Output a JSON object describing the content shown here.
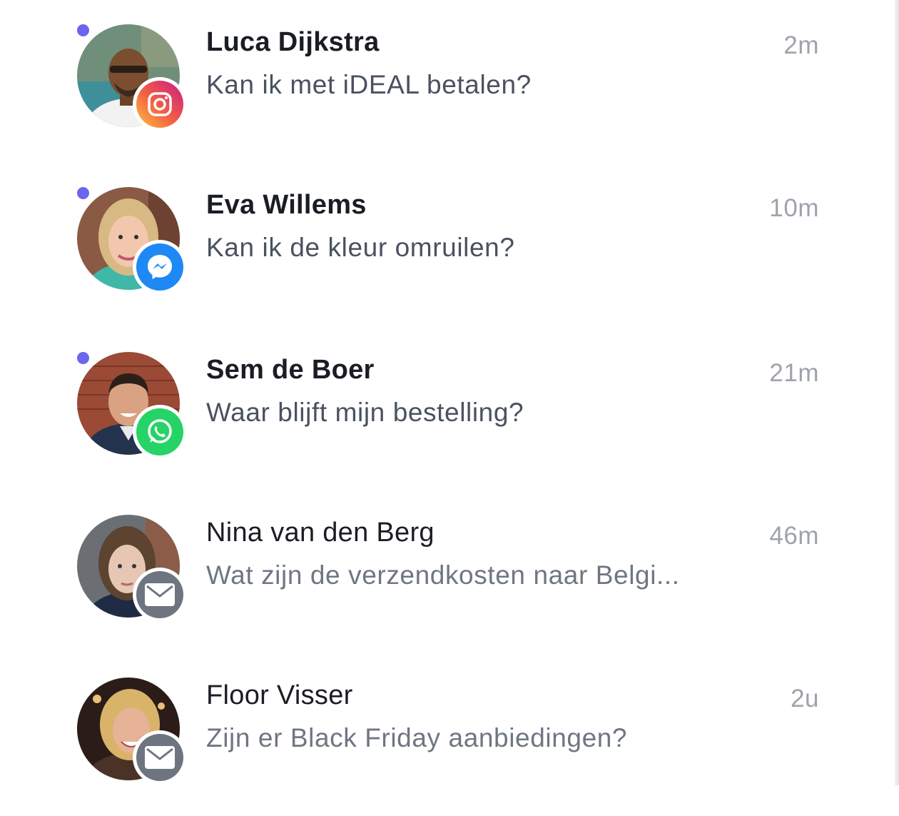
{
  "conversations": [
    {
      "name": "Luca Dijkstra",
      "message": "Kan ik met iDEAL betalen?",
      "time": "2m",
      "unread": true,
      "channel": "instagram-icon"
    },
    {
      "name": "Eva Willems",
      "message": "Kan ik de kleur omruilen?",
      "time": "10m",
      "unread": true,
      "channel": "messenger-icon"
    },
    {
      "name": "Sem de Boer",
      "message": "Waar blijft mijn bestelling?",
      "time": "21m",
      "unread": true,
      "channel": "whatsapp-icon"
    },
    {
      "name": "Nina van den Berg",
      "message": "Wat zijn de verzendkosten naar Belgi...",
      "time": "46m",
      "unread": false,
      "channel": "mail-icon"
    },
    {
      "name": "Floor Visser",
      "message": "Zijn er Black Friday aanbiedingen?",
      "time": "2u",
      "unread": false,
      "channel": "mail-icon"
    }
  ],
  "colors": {
    "unread_dot": "#6b66ee",
    "messenger": "#1e88f5",
    "whatsapp": "#25d366",
    "mail": "#6e7581",
    "instagram_start": "#fdc248",
    "instagram_end": "#c61c8a"
  }
}
